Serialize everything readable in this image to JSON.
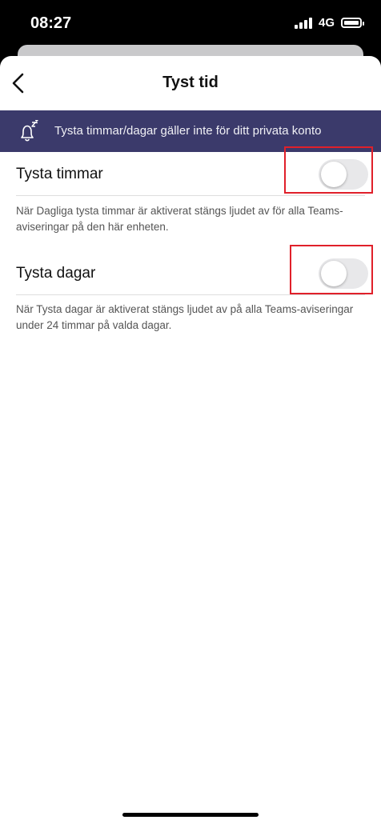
{
  "status_bar": {
    "time": "08:27",
    "network": "4G",
    "battery_level": 1.0
  },
  "nav": {
    "title": "Tyst tid",
    "back_icon": "chevron-left-icon"
  },
  "banner": {
    "icon": "bell-snooze-icon",
    "text": "Tysta timmar/dagar gäller inte för ditt privata konto"
  },
  "settings": [
    {
      "label": "Tysta timmar",
      "enabled": false,
      "description": "När Dagliga tysta timmar är aktiverat stängs ljudet av för alla Teams-aviseringar på den här enheten."
    },
    {
      "label": "Tysta dagar",
      "enabled": false,
      "description": "När Tysta dagar är aktiverat stängs ljudet av på alla Teams-aviseringar under 24 timmar på valda dagar."
    }
  ],
  "colors": {
    "banner_bg": "#3b3a6b",
    "highlight": "#e0202a",
    "toggle_off": "#e8e8ea"
  }
}
